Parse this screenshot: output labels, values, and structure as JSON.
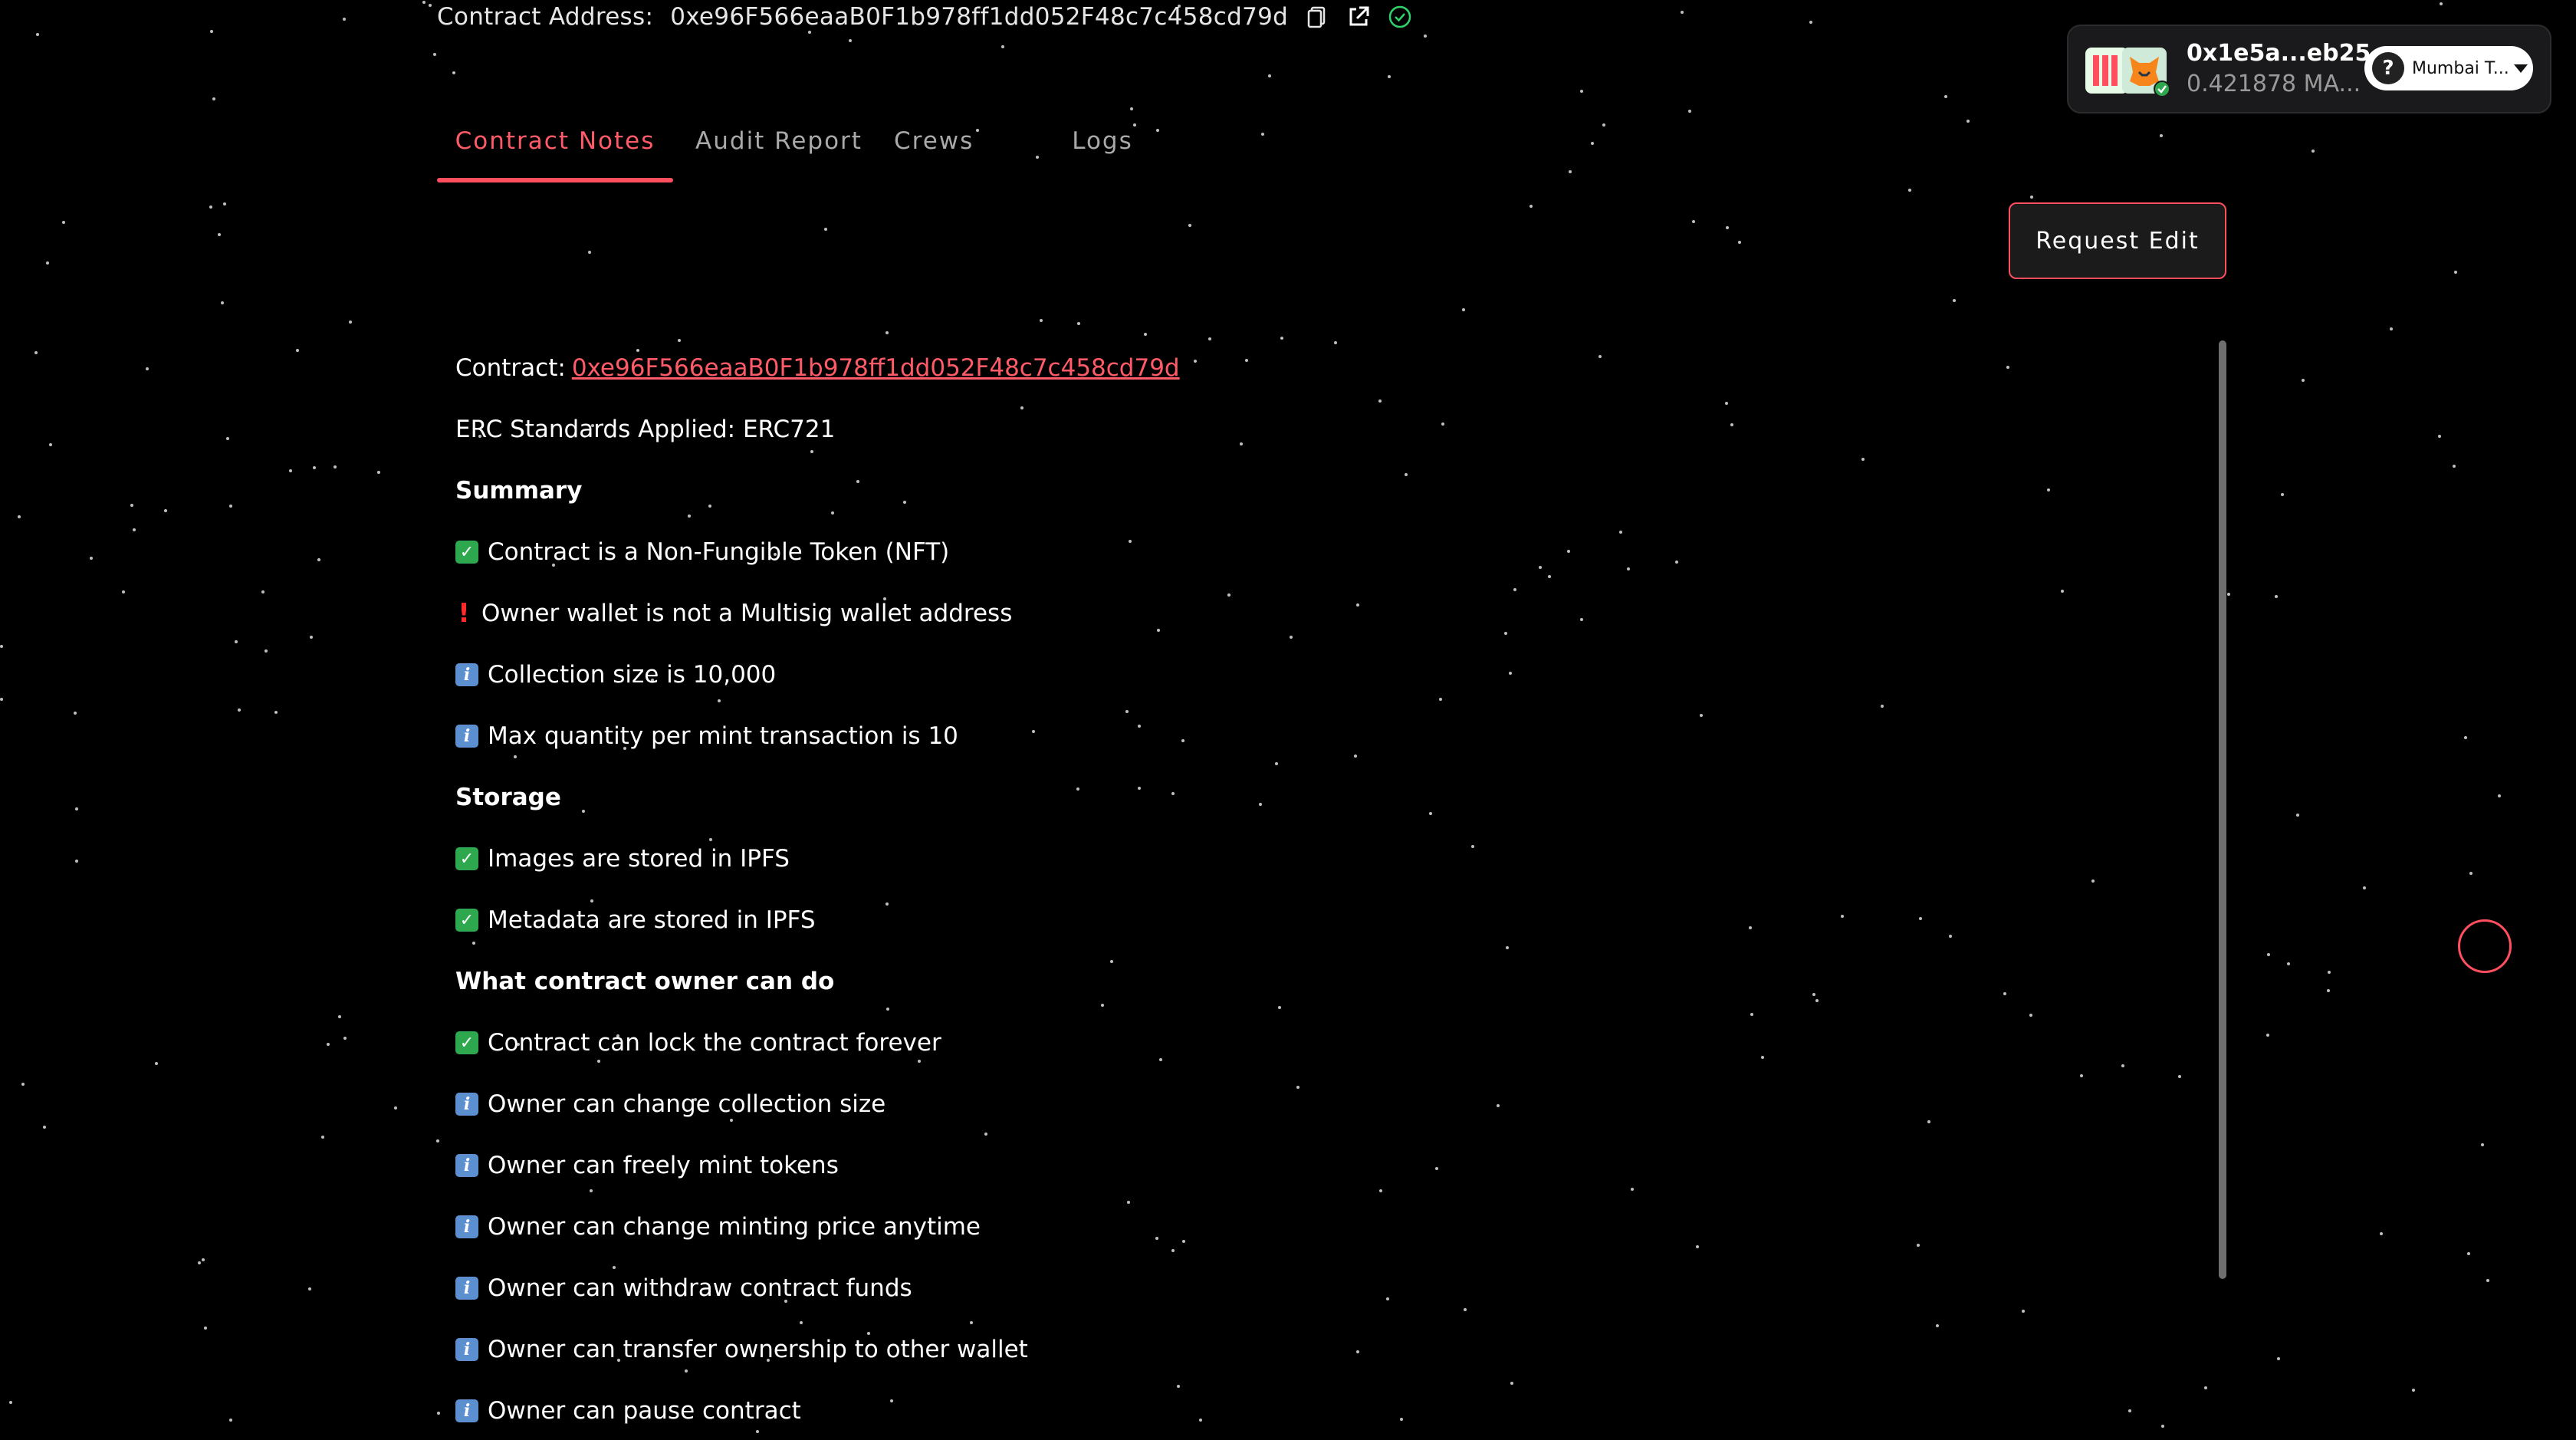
{
  "contract_address_bar": {
    "label": "Contract Address:",
    "value": "0xe96F566eaaB0F1b978ff1dd052F48c7c458cd79d"
  },
  "tabs": [
    {
      "label": "Contract Notes",
      "active": true
    },
    {
      "label": "Audit Report",
      "active": false
    },
    {
      "label": "Crews",
      "active": false
    },
    {
      "label": "Logs",
      "active": false
    }
  ],
  "request_edit_label": "Request Edit",
  "wallet": {
    "address": "0x1e5a...eb25",
    "balance": "0.421878 MA...",
    "network_label": "Mumbai T...",
    "help_glyph": "?"
  },
  "notes": {
    "contract_label": "Contract:",
    "contract_link": "0xe96F566eaaB0F1b978ff1dd052F48c7c458cd79d",
    "erc_standards": "ERC Standards Applied: ERC721",
    "summary_heading": "Summary",
    "summary_items": [
      {
        "icon": "check",
        "text": "Contract is a Non-Fungible Token (NFT)"
      },
      {
        "icon": "exclamation",
        "text": "Owner wallet is not a Multisig wallet address"
      },
      {
        "icon": "info",
        "text": "Collection size is 10,000"
      },
      {
        "icon": "info",
        "text": "Max quantity per mint transaction is 10"
      }
    ],
    "storage_heading": "Storage",
    "storage_items": [
      {
        "icon": "check",
        "text": "Images are stored in IPFS"
      },
      {
        "icon": "check",
        "text": "Metadata are stored in IPFS"
      }
    ],
    "owner_heading": "What contract owner can do",
    "owner_items": [
      {
        "icon": "check",
        "text": "Contract can lock the contract forever"
      },
      {
        "icon": "info",
        "text": "Owner can change collection size"
      },
      {
        "icon": "info",
        "text": "Owner can freely mint tokens"
      },
      {
        "icon": "info",
        "text": "Owner can change minting price anytime"
      },
      {
        "icon": "info",
        "text": "Owner can withdraw contract funds"
      },
      {
        "icon": "info",
        "text": "Owner can transfer ownership to other wallet"
      },
      {
        "icon": "info",
        "text": "Owner can pause contract"
      }
    ]
  },
  "colors": {
    "accent": "#ff4f5e",
    "background": "#000000",
    "check_green": "#2ea84f",
    "info_blue": "#5c8fcf"
  }
}
